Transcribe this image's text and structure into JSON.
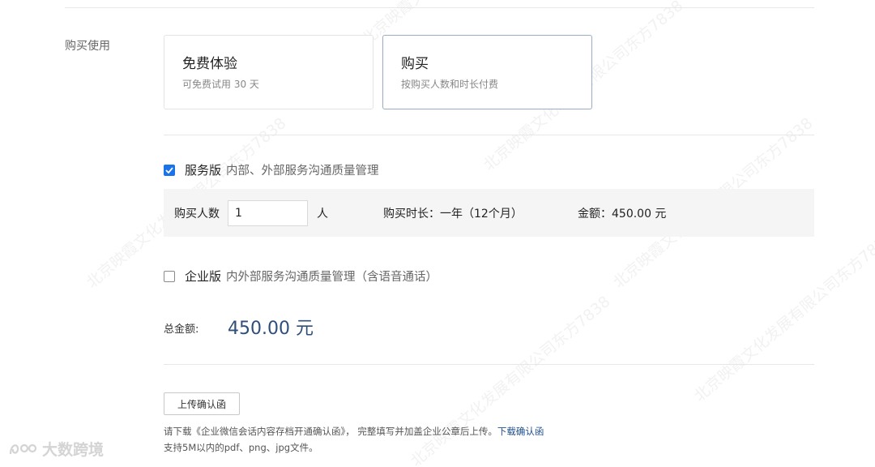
{
  "section": {
    "label": "购买使用"
  },
  "plans": {
    "free": {
      "title": "免费体验",
      "subtitle": "可免费试用 30 天"
    },
    "buy": {
      "title": "购买",
      "subtitle": "按购买人数和时长付费",
      "selected": true
    }
  },
  "editions": {
    "service": {
      "name": "服务版",
      "description": "内部、外部服务沟通质量管理",
      "checked": true,
      "purchase": {
        "quantity_label": "购买人数",
        "quantity_value": "1",
        "quantity_unit": "人",
        "duration_text": "购买时长：一年（12个月）",
        "amount_text": "金额：450.00 元"
      }
    },
    "enterprise": {
      "name": "企业版",
      "description": "内外部服务沟通质量管理（含语音通话）",
      "checked": false
    }
  },
  "total": {
    "label": "总金额:",
    "value": "450.00 元"
  },
  "upload": {
    "button_label": "上传确认函",
    "note_text": "请下载《企业微信会话内容存档开通确认函》， 完整填写并加盖企业公章后上传。",
    "note_link": "下载确认函",
    "note_formats": "支持5M以内的pdf、png、jpg文件。"
  },
  "watermark": {
    "text": "北京映霞文化发展有限公司东方7838",
    "logo_text": "大数跨境"
  },
  "colors": {
    "accent": "#1a73e8",
    "total": "#2f4f7a",
    "link": "#1f4f8f",
    "selected_border": "#98adc5"
  }
}
